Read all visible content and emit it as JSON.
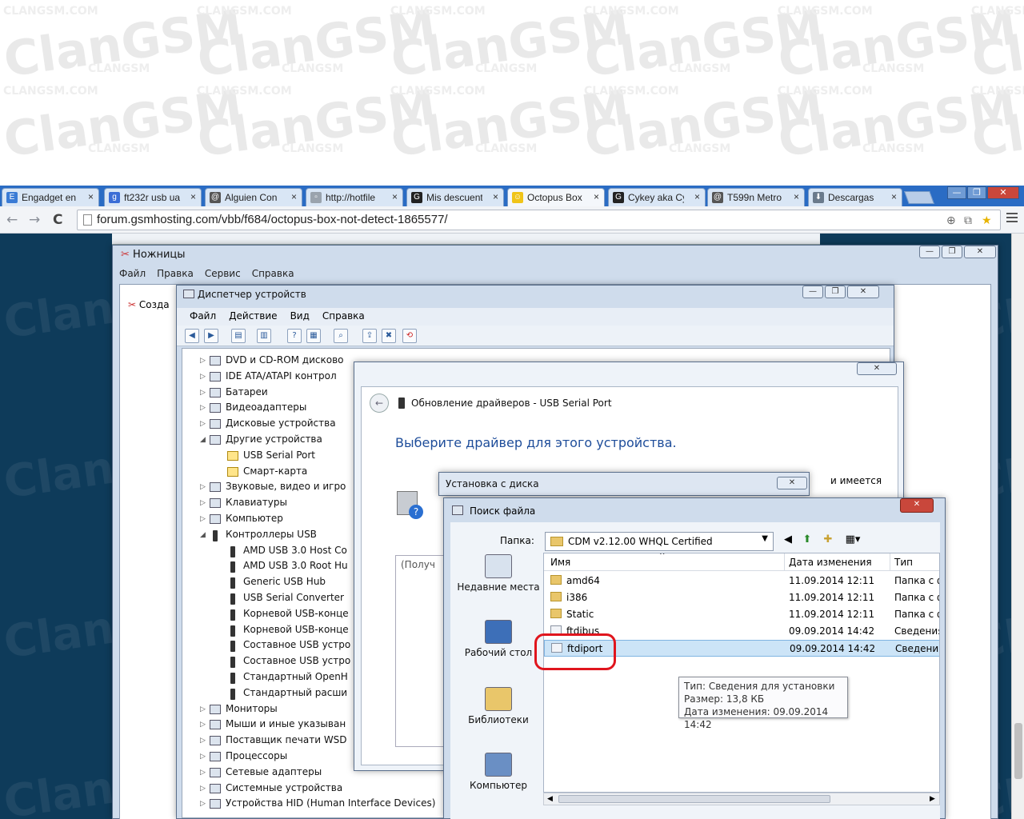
{
  "browser": {
    "tabs": [
      {
        "label": "Engadget en",
        "icon_color": "#3a7bd5",
        "glyph": "E"
      },
      {
        "label": "ft232r usb ua",
        "icon_color": "#3b6dd6",
        "glyph": "g"
      },
      {
        "label": "Alguien Con",
        "icon_color": "#555555",
        "glyph": "@"
      },
      {
        "label": "http://hotfile",
        "icon_color": "#9aa3ad",
        "glyph": "▫"
      },
      {
        "label": "Mis descuent",
        "icon_color": "#222222",
        "glyph": "G"
      },
      {
        "label": "Octopus Box",
        "icon_color": "#f0c419",
        "glyph": "☺"
      },
      {
        "label": "Cykey aka Cy",
        "icon_color": "#222222",
        "glyph": "G"
      },
      {
        "label": "T599n Metro",
        "icon_color": "#555555",
        "glyph": "@"
      },
      {
        "label": "Descargas",
        "icon_color": "#6a7a8c",
        "glyph": "⬇"
      }
    ],
    "active_tab": 5,
    "url": "forum.gsmhosting.com/vbb/f684/octopus-box-not-detect-1865577/",
    "close_glyph": "×",
    "nav": {
      "back": "←",
      "forward": "→",
      "reload": "C"
    },
    "omni_icons": {
      "zoom": "⊕",
      "translate": "⧉",
      "star": "★"
    },
    "window_controls": {
      "minimize": "—",
      "restore": "❐",
      "close": "✕"
    }
  },
  "watermark": {
    "brand": "ClanGSM",
    "small": "CLANGSM.COM",
    "caps": "CLANGSM"
  },
  "snipping_tool": {
    "title": "Ножницы",
    "menu": [
      "Файл",
      "Правка",
      "Сервис",
      "Справка"
    ],
    "new_label": "Созда"
  },
  "device_manager": {
    "title": "Диспетчер устройств",
    "menu": [
      "Файл",
      "Действие",
      "Вид",
      "Справка"
    ],
    "toolbar_icons": [
      "back-icon",
      "forward-icon",
      "properties-icon",
      "list-icon",
      "help-icon",
      "view-icon",
      "scan-icon",
      "update-icon",
      "uninstall-icon",
      "disable-icon"
    ],
    "tree": [
      {
        "label": "DVD и CD-ROM дисково",
        "level": 0,
        "expanded": false,
        "icon": "cdrom"
      },
      {
        "label": "IDE ATA/ATAPI контрол",
        "level": 0,
        "expanded": false,
        "icon": "ide"
      },
      {
        "label": "Батареи",
        "level": 0,
        "expanded": false,
        "icon": "battery"
      },
      {
        "label": "Видеоадаптеры",
        "level": 0,
        "expanded": false,
        "icon": "display"
      },
      {
        "label": "Дисковые устройства",
        "level": 0,
        "expanded": false,
        "icon": "disk"
      },
      {
        "label": "Другие устройства",
        "level": 0,
        "expanded": true,
        "icon": "other"
      },
      {
        "label": "USB Serial Port",
        "level": 1,
        "icon": "warn"
      },
      {
        "label": "Смарт-карта",
        "level": 1,
        "icon": "warn"
      },
      {
        "label": "Звуковые, видео и игро",
        "level": 0,
        "expanded": false,
        "icon": "sound"
      },
      {
        "label": "Клавиатуры",
        "level": 0,
        "expanded": false,
        "icon": "keyboard"
      },
      {
        "label": "Компьютер",
        "level": 0,
        "expanded": false,
        "icon": "computer"
      },
      {
        "label": "Контроллеры USB",
        "level": 0,
        "expanded": true,
        "icon": "usb"
      },
      {
        "label": "AMD USB 3.0 Host Co",
        "level": 1,
        "icon": "usb"
      },
      {
        "label": "AMD USB 3.0 Root Hu",
        "level": 1,
        "icon": "usb"
      },
      {
        "label": "Generic USB Hub",
        "level": 1,
        "icon": "usb"
      },
      {
        "label": "USB Serial Converter",
        "level": 1,
        "icon": "usb"
      },
      {
        "label": "Корневой USB-конце",
        "level": 1,
        "icon": "usb"
      },
      {
        "label": "Корневой USB-конце",
        "level": 1,
        "icon": "usb"
      },
      {
        "label": "Составное USB устро",
        "level": 1,
        "icon": "usb"
      },
      {
        "label": "Составное USB устро",
        "level": 1,
        "icon": "usb"
      },
      {
        "label": "Стандартный OpenH",
        "level": 1,
        "icon": "usb"
      },
      {
        "label": "Стандартный расши",
        "level": 1,
        "icon": "usb"
      },
      {
        "label": "Мониторы",
        "level": 0,
        "expanded": false,
        "icon": "monitor"
      },
      {
        "label": "Мыши и иные указыван",
        "level": 0,
        "expanded": false,
        "icon": "mouse"
      },
      {
        "label": "Поставщик печати WSD",
        "level": 0,
        "expanded": false,
        "icon": "printer"
      },
      {
        "label": "Процессоры",
        "level": 0,
        "expanded": false,
        "icon": "cpu"
      },
      {
        "label": "Сетевые адаптеры",
        "level": 0,
        "expanded": false,
        "icon": "network"
      },
      {
        "label": "Системные устройства",
        "level": 0,
        "expanded": false,
        "icon": "system"
      },
      {
        "label": "Устройства HID (Human Interface Devices)",
        "level": 0,
        "expanded": false,
        "icon": "hid"
      }
    ]
  },
  "update_driver": {
    "title": "Обновление драйверов - USB Serial Port",
    "heading": "Выберите драйвер для этого устройства.",
    "partial_text": "и имеется",
    "box_text": "(Получ"
  },
  "install_from_disk": {
    "title": "Установка с диска"
  },
  "browse": {
    "title": "Поиск файла",
    "look_in_label": "Папка:",
    "look_in_value": "CDM v2.12.00 WHQL Certified",
    "places": [
      {
        "label": "Недавние места",
        "icon": "recent-places-icon"
      },
      {
        "label": "Рабочий стол",
        "icon": "desktop-icon"
      },
      {
        "label": "Библиотеки",
        "icon": "libraries-icon"
      },
      {
        "label": "Компьютер",
        "icon": "computer-icon"
      }
    ],
    "columns": [
      "Имя",
      "Дата изменения",
      "Тип"
    ],
    "files": [
      {
        "name": "amd64",
        "date": "11.09.2014 12:11",
        "type": "Папка с ф",
        "kind": "folder"
      },
      {
        "name": "i386",
        "date": "11.09.2014 12:11",
        "type": "Папка с ф",
        "kind": "folder"
      },
      {
        "name": "Static",
        "date": "11.09.2014 12:11",
        "type": "Папка с ф",
        "kind": "folder"
      },
      {
        "name": "ftdibus",
        "date": "09.09.2014 14:42",
        "type": "Сведения",
        "kind": "inf"
      },
      {
        "name": "ftdiport",
        "date": "09.09.2014 14:42",
        "type": "Сведения",
        "kind": "inf"
      }
    ],
    "selected_index": 4,
    "tooltip": {
      "type": "Тип: Сведения для установки",
      "size": "Размер: 13,8 КБ",
      "modified": "Дата изменения: 09.09.2014 14:42"
    }
  }
}
